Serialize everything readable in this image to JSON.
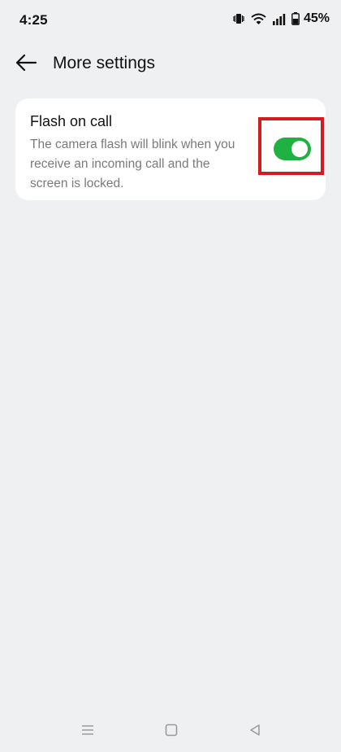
{
  "status_bar": {
    "time": "4:25",
    "battery": "45%",
    "icons": [
      "vibrate-icon",
      "wifi-icon",
      "signal-icon",
      "battery-icon"
    ]
  },
  "header": {
    "back_icon": "arrow-left-icon",
    "title": "More settings"
  },
  "setting": {
    "title": "Flash on call",
    "description": "The camera flash will blink when you receive an incoming call and the screen is locked.",
    "enabled": true,
    "toggle_color": "#1fb141",
    "highlight_color": "#d71921"
  },
  "nav_bar": {
    "buttons": [
      "menu-icon",
      "home-icon",
      "back-triangle-icon"
    ]
  }
}
